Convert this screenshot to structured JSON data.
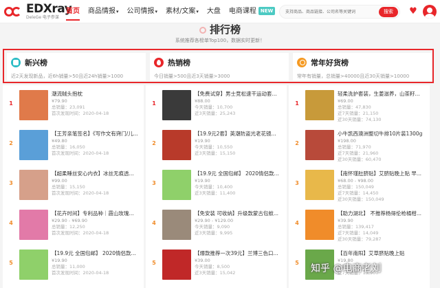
{
  "brand": {
    "name": "EDXray",
    "tagline": "DeleGe 电子参谋"
  },
  "nav": [
    {
      "label": "首页",
      "active": true,
      "caret": false
    },
    {
      "label": "商品情报",
      "active": false,
      "caret": true
    },
    {
      "label": "公司情报",
      "active": false,
      "caret": true
    },
    {
      "label": "素材/文案",
      "active": false,
      "caret": true
    },
    {
      "label": "大盘",
      "active": false,
      "caret": false
    },
    {
      "label": "电商课程",
      "active": false,
      "caret": false,
      "badge": "NEW"
    }
  ],
  "search": {
    "placeholder": "支持商品、商品链接、公司名等关键词",
    "button": "搜索"
  },
  "page": {
    "title": "排行榜",
    "subtitle": "系统推荐各榜单Top100，数据实时更新！"
  },
  "categories": [
    {
      "title": "新兴榜",
      "desc": "近2天发现新品，近6h销量>50且近24h销量>1000",
      "color": "#2bbcc5"
    },
    {
      "title": "热销榜",
      "desc": "今日销量>500且近3天销量>3000",
      "color": "#e8262a"
    },
    {
      "title": "常年好货榜",
      "desc": "常年有销量，总销量>40000且近30天销量>10000",
      "color": "#f59a23"
    }
  ],
  "columns": [
    {
      "items": [
        {
          "rank": "1",
          "title": "潮流贼头抱枕",
          "price": "¥79.90",
          "metric": "总销量：23,091",
          "date": "首次发现时间：2020-04-18",
          "thumb": "#e07a4a"
        },
        {
          "rank": "2",
          "title": "【王芳亲笔签名】《写作文有窍门/儿...",
          "price": "¥49.80",
          "metric": "总销量：16,050",
          "date": "首次发现时间：2020-04-18",
          "thumb": "#5a9fd8"
        },
        {
          "rank": "3",
          "title": "【超柔睡丝安心内衣】冰丝无痕透...",
          "price": "¥99.00",
          "metric": "总销量：15,150",
          "date": "首次发现时间：2020-04-18",
          "thumb": "#d6a08a"
        },
        {
          "rank": "4",
          "title": "【花卉时间】专利品种｜霞山玫瑰...",
          "price": "¥29.90 - ¥69.90",
          "metric": "总销量：12,250",
          "date": "首次发现时间：2020-04-18",
          "thumb": "#e27aa8"
        },
        {
          "rank": "5",
          "title": "【19.9元 全国包邮】 2020情侣款...",
          "price": "¥19.90",
          "metric": "总销量：11,000",
          "date": "首次发现时间：2020-04-18",
          "thumb": "#8fd06a"
        }
      ]
    },
    {
      "items": [
        {
          "rank": "1",
          "title": "【免费试穿】男士竞松速干运动套...",
          "price": "¥88.00",
          "metric": "今天销量：10,700",
          "date": "近3天销量：25,243",
          "thumb": "#3a3a3a"
        },
        {
          "rank": "2",
          "title": "【19.9元2套】英潮防盗光老花镜...",
          "price": "¥19.90",
          "metric": "今天销量：10,550",
          "date": "近3天销量：15,150",
          "thumb": "#b83a2a"
        },
        {
          "rank": "3",
          "title": "【19.9元 全国包邮】 2020情侣款...",
          "price": "¥19.90",
          "metric": "今天销量：10,400",
          "date": "近3天销量：11,400",
          "thumb": "#8fd06a"
        },
        {
          "rank": "4",
          "title": "【免安装 可收纳】升级款蒙古包蚊...",
          "price": "¥29.90 - ¥129.00",
          "metric": "今天销量：9,090",
          "date": "近3天销量：9,995",
          "thumb": "#9a8a7a"
        },
        {
          "rank": "5",
          "title": "【爆款推荐一次39元】兰博三色口...",
          "price": "¥39.00",
          "metric": "今天销量：8,500",
          "date": "近3天销量：15,042",
          "thumb": "#c02828"
        }
      ]
    },
    {
      "items": [
        {
          "rank": "1",
          "title": "轻柔洗护套装，生姜滋养，山茶籽...",
          "price": "¥69.00",
          "metric": "总销量：47,830",
          "date": "近7天销量：21,150",
          "sub": "近30天销量：74,130",
          "thumb": "#c89a3a"
        },
        {
          "rank": "2",
          "title": "小牛凯西澳洲整切牛排10片装1300g",
          "price": "¥198.00",
          "metric": "总销量：71,970",
          "date": "近7天销量：21,960",
          "sub": "近30天销量：60,470",
          "thumb": "#b84a3a"
        },
        {
          "rank": "3",
          "title": "【南怀瑾肚脐贴】艾脐贴晚上贴 早...",
          "price": "¥68.00 - ¥98.00",
          "metric": "总销量：150,049",
          "date": "近7天销量：14,450",
          "sub": "近30天销量：150,049",
          "thumb": "#e8b84a"
        },
        {
          "rank": "4",
          "title": "【助力湖北】 不推荐杨得伦枪橘柑...",
          "price": "¥39.90",
          "metric": "总销量：139,417",
          "date": "近7天销量：14,049",
          "sub": "近30天销量：79,287",
          "thumb": "#f08c2a"
        },
        {
          "rank": "5",
          "title": "【百年南阳】艾草脐贴晚上贴",
          "price": "¥19.80",
          "metric": "总销量：79,025",
          "date": "近7天销量：13,900",
          "sub": "",
          "thumb": "#6aa84a"
        }
      ]
    }
  ],
  "watermark": "知乎 @电商老刘"
}
